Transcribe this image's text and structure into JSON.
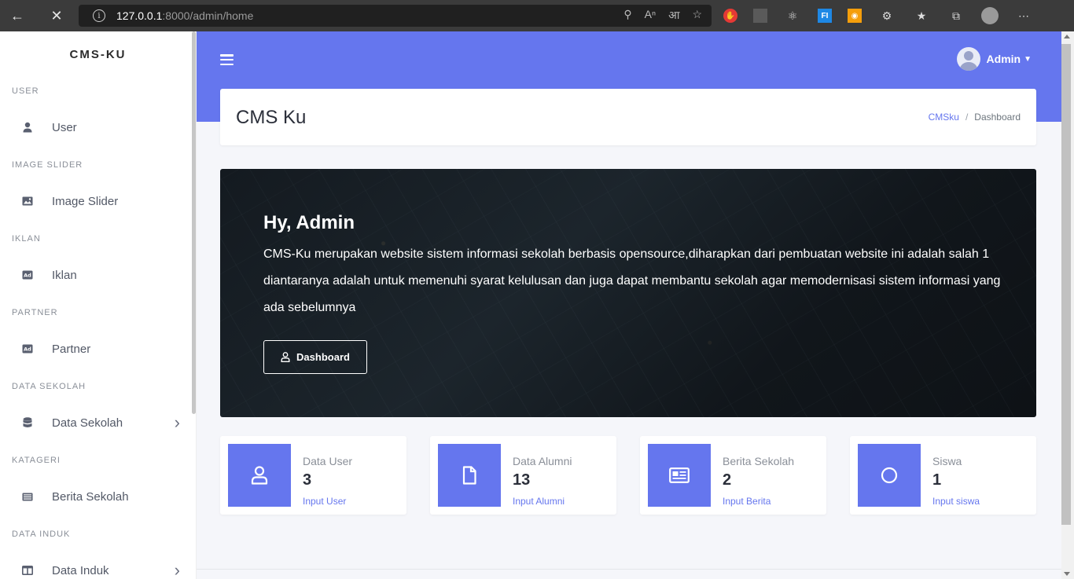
{
  "browser": {
    "url_host": "127.0.0.1",
    "url_path": ":8000/admin/home"
  },
  "sidebar": {
    "brand": "CMS-KU",
    "sections": [
      {
        "heading": "USER",
        "item": "User",
        "icon": "user-icon",
        "has_chevron": false
      },
      {
        "heading": "IMAGE SLIDER",
        "item": "Image Slider",
        "icon": "image-icon",
        "has_chevron": false
      },
      {
        "heading": "IKLAN",
        "item": "Iklan",
        "icon": "ad-icon",
        "has_chevron": false
      },
      {
        "heading": "PARTNER",
        "item": "Partner",
        "icon": "ad-icon",
        "has_chevron": false
      },
      {
        "heading": "DATA SEKOLAH",
        "item": "Data Sekolah",
        "icon": "database-icon",
        "has_chevron": true
      },
      {
        "heading": "KATAGERI",
        "item": "Berita Sekolah",
        "icon": "newspaper-icon",
        "has_chevron": false
      },
      {
        "heading": "DATA INDUK",
        "item": "Data Induk",
        "icon": "columns-icon",
        "has_chevron": true
      }
    ]
  },
  "header": {
    "user_name": "Admin",
    "accent_color": "#6576ee"
  },
  "page": {
    "title": "CMS Ku",
    "breadcrumb": [
      "CMSku",
      "Dashboard"
    ]
  },
  "hero": {
    "greeting": "Hy, Admin",
    "description": "CMS-Ku merupakan website sistem informasi sekolah berbasis opensource,diharapkan dari pembuatan website ini adalah salah 1 diantaranya adalah untuk memenuhi syarat kelulusan dan juga dapat membantu sekolah agar memodernisasi sistem informasi yang ada sebelumnya",
    "button_label": "Dashboard"
  },
  "stats": [
    {
      "title": "Data User",
      "value": "3",
      "link": "Input User",
      "icon": "user-icon"
    },
    {
      "title": "Data Alumni",
      "value": "13",
      "link": "Input Alumni",
      "icon": "file-icon"
    },
    {
      "title": "Berita Sekolah",
      "value": "2",
      "link": "Input Berita",
      "icon": "newspaper-icon"
    },
    {
      "title": "Siswa",
      "value": "1",
      "link": "Input siswa",
      "icon": "circle-icon"
    }
  ]
}
